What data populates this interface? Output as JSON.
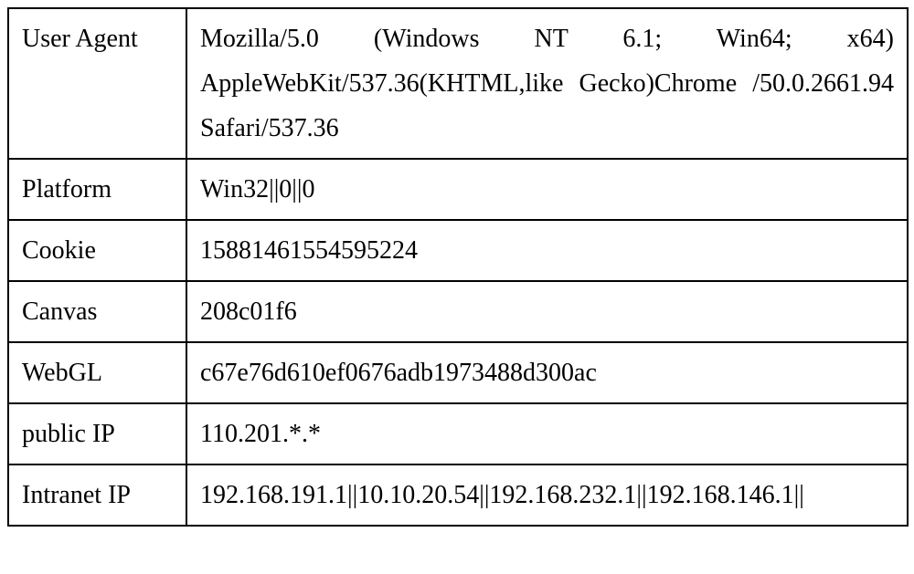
{
  "rows": [
    {
      "key": "User Agent",
      "value": "Mozilla/5.0 (Windows NT 6.1; Win64; x64) AppleWebKit/537.36(KHTML,like Gecko)Chrome /50.0.2661.94 Safari/537.36"
    },
    {
      "key": "Platform",
      "value": "Win32||0||0"
    },
    {
      "key": "Cookie",
      "value": "15881461554595224"
    },
    {
      "key": "Canvas",
      "value": "208c01f6"
    },
    {
      "key": "WebGL",
      "value": "c67e76d610ef0676adb1973488d300ac"
    },
    {
      "key": "public IP",
      "value": "110.201.*.*"
    },
    {
      "key": "Intranet IP",
      "value": "192.168.191.1||10.10.20.54||192.168.232.1||192.168.146.1||"
    }
  ]
}
